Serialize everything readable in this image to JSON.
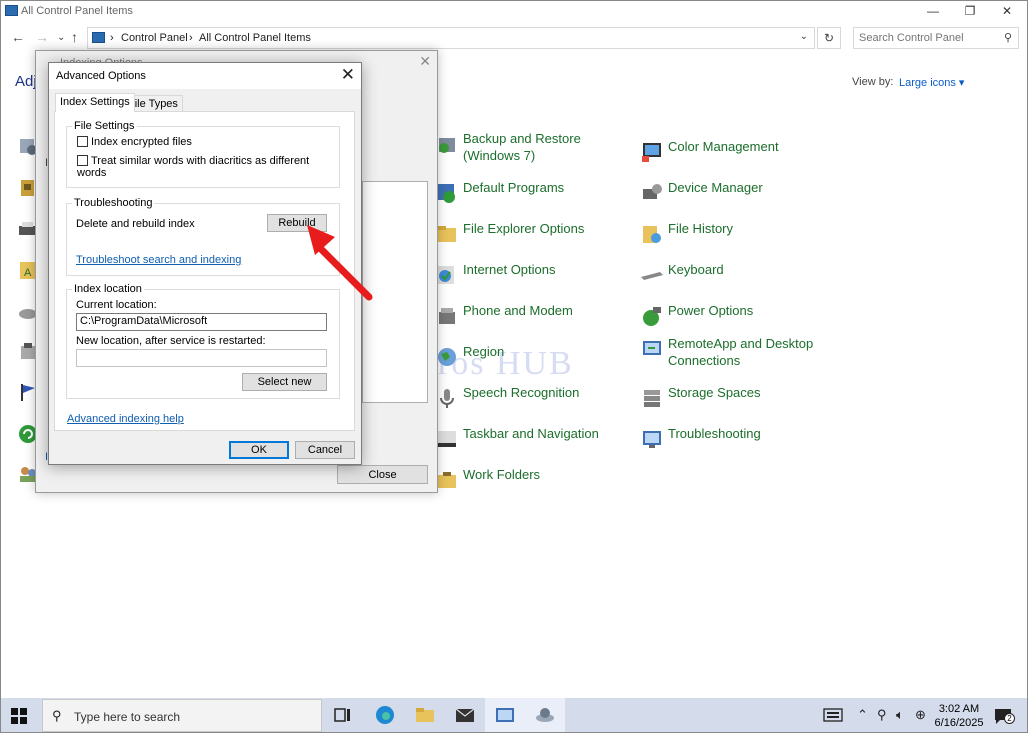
{
  "window": {
    "title": "All Control Panel Items",
    "minimize": "—",
    "maximize": "❐",
    "close": "✕"
  },
  "address": {
    "breadcrumb": [
      "Control Panel",
      "All Control Panel Items"
    ],
    "separator": "›",
    "search_placeholder": "Search Control Panel"
  },
  "header": {
    "adjust_text": "Adj",
    "view_by_label": "View by:",
    "view_by_value": "Large icons ▾"
  },
  "watermark": "IT Pros HUB",
  "items": [
    {
      "label": "Backup and Restore\n(Windows 7)",
      "icon": "backup-restore-icon"
    },
    {
      "label": "Color Management",
      "icon": "color-management-icon"
    },
    {
      "label": "Default Programs",
      "icon": "default-programs-icon"
    },
    {
      "label": "Device Manager",
      "icon": "device-manager-icon"
    },
    {
      "label": "File Explorer Options",
      "icon": "file-explorer-options-icon"
    },
    {
      "label": "File History",
      "icon": "file-history-icon"
    },
    {
      "label": "Internet Options",
      "icon": "internet-options-icon"
    },
    {
      "label": "Keyboard",
      "icon": "keyboard-icon"
    },
    {
      "label": "Phone and Modem",
      "icon": "phone-modem-icon"
    },
    {
      "label": "Power Options",
      "icon": "power-options-icon"
    },
    {
      "label": "Region",
      "icon": "region-icon"
    },
    {
      "label": "RemoteApp and Desktop\nConnections",
      "icon": "remoteapp-icon"
    },
    {
      "label": "Speech Recognition",
      "icon": "speech-recognition-icon"
    },
    {
      "label": "Storage Spaces",
      "icon": "storage-spaces-icon"
    },
    {
      "label": "Taskbar and Navigation",
      "icon": "taskbar-navigation-icon"
    },
    {
      "label": "Troubleshooting",
      "icon": "troubleshooting-icon"
    },
    {
      "label": "Work Folders",
      "icon": "work-folders-icon"
    }
  ],
  "indexing_window": {
    "title": "Indexing Options",
    "close_button": "Close",
    "side_letters": [
      "I",
      "I"
    ]
  },
  "advanced": {
    "title": "Advanced Options",
    "tabs": [
      "Index Settings",
      "File Types"
    ],
    "file_settings": {
      "legend": "File Settings",
      "option1": "Index encrypted files",
      "option2": "Treat similar words with diacritics as different words"
    },
    "troubleshooting": {
      "legend": "Troubleshooting",
      "label": "Delete and rebuild index",
      "rebuild_button": "Rebuild",
      "link": "Troubleshoot search and indexing"
    },
    "index_location": {
      "legend": "Index location",
      "current_label": "Current location:",
      "current_value": "C:\\ProgramData\\Microsoft",
      "new_label": "New location, after service is restarted:",
      "new_value": "",
      "select_button": "Select new"
    },
    "help_link": "Advanced indexing help",
    "ok_button": "OK",
    "cancel_button": "Cancel"
  },
  "taskbar": {
    "search_text": "Type here to search",
    "time": "3:02 AM",
    "date": "6/16/2025",
    "notification_count": "2"
  },
  "colors": {
    "link_green": "#1b6e2b",
    "link_blue": "#0f5eb0",
    "accent": "#0078d7",
    "arrow_red": "#e81c1c"
  }
}
